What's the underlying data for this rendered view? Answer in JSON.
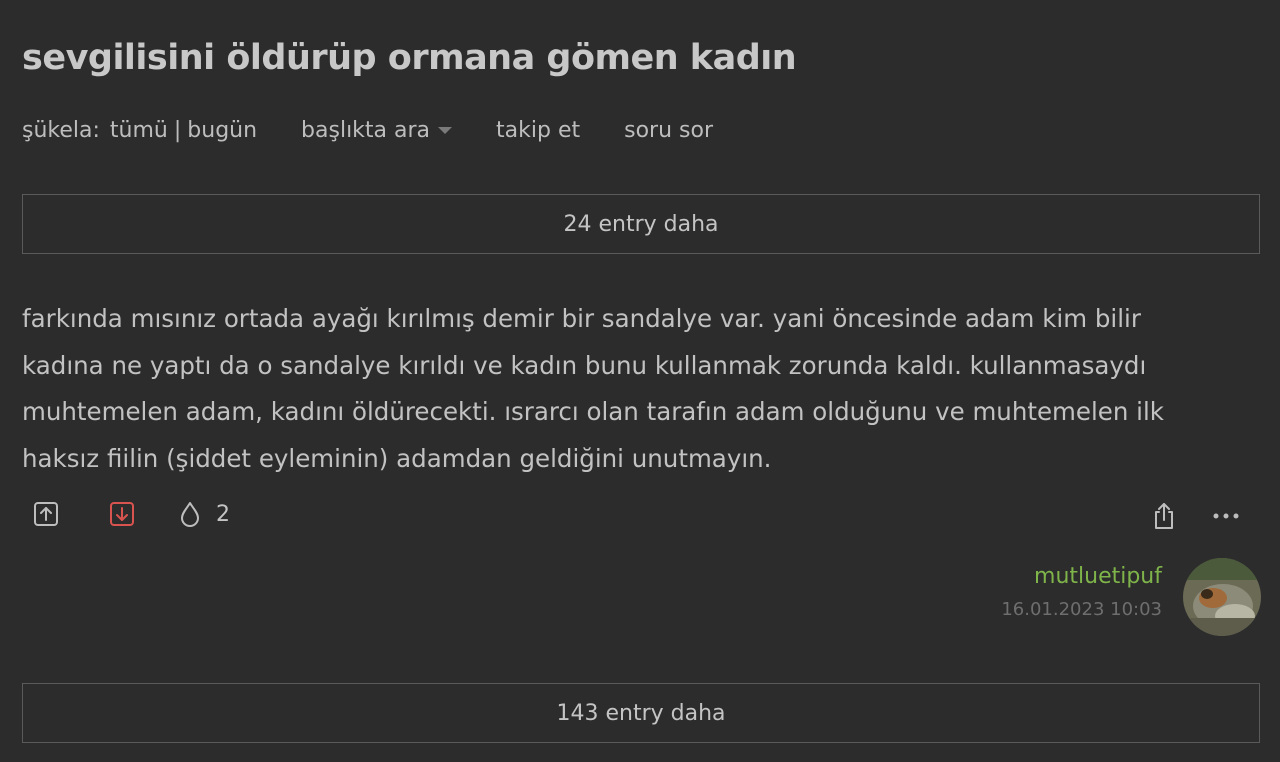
{
  "topic": {
    "title": "sevgilisini öldürüp ormana gömen kadın"
  },
  "subnav": {
    "sukela_label": "şükela:",
    "all_label": "tümü",
    "separator": "|",
    "today_label": "bugün",
    "search_label": "başlıkta ara",
    "follow_label": "takip et",
    "ask_label": "soru sor"
  },
  "more_entries_top": "24 entry daha",
  "entry": {
    "content": "farkında mısınız ortada ayağı kırılmış demir bir sandalye var. yani öncesinde adam kim bilir kadına ne yaptı da o sandalye kırıldı ve kadın bunu kullanmak zorunda kaldı. kullanmasaydı muhtemelen adam, kadını öldürecekti. ısrarcı olan tarafın adam olduğunu ve muhtemelen ilk haksız fiilin (şiddet eyleminin) adamdan geldiğini unutmayın.",
    "fav_count": "2",
    "author": "mutluetipuf",
    "date": "16.01.2023 10:03",
    "icons": {
      "upvote": "upvote-icon",
      "downvote": "downvote-icon",
      "favorite": "drop-icon",
      "share": "share-icon",
      "more": "more-icon"
    }
  },
  "more_entries_bottom": "143 entry daha",
  "colors": {
    "background": "#2c2c2c",
    "text": "#bdbdbd",
    "author": "#7fb44a",
    "downvote_active": "#d9534f",
    "date": "#6e6e6e"
  }
}
